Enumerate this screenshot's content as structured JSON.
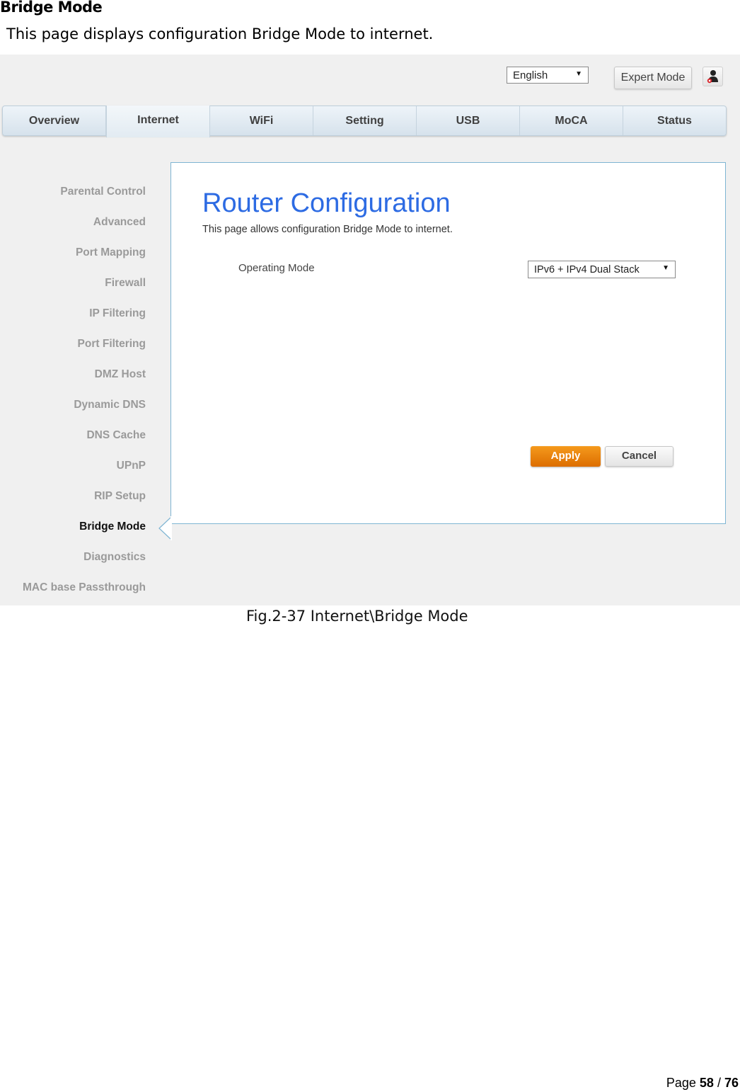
{
  "document": {
    "heading": "Bridge Mode",
    "intro": "This page displays configuration Bridge Mode to internet.",
    "caption": "Fig.2-37 Internet\\Bridge Mode",
    "page_label": "Page",
    "page_current": "58",
    "page_separator": "/",
    "page_total": "76"
  },
  "header": {
    "language": {
      "selected": "English",
      "icon": "dropdown-arrow-icon"
    },
    "expert_mode_label": "Expert Mode",
    "user_icon": "user-logout-icon"
  },
  "tabs": [
    {
      "label": "Overview",
      "active": false
    },
    {
      "label": "Internet",
      "active": true
    },
    {
      "label": "WiFi",
      "active": false
    },
    {
      "label": "Setting",
      "active": false
    },
    {
      "label": "USB",
      "active": false
    },
    {
      "label": "MoCA",
      "active": false
    },
    {
      "label": "Status",
      "active": false
    }
  ],
  "sidebar": {
    "items": [
      {
        "label": "Parental Control",
        "active": false
      },
      {
        "label": "Advanced",
        "active": false
      },
      {
        "label": "Port Mapping",
        "active": false
      },
      {
        "label": "Firewall",
        "active": false
      },
      {
        "label": "IP Filtering",
        "active": false
      },
      {
        "label": "Port Filtering",
        "active": false
      },
      {
        "label": "DMZ Host",
        "active": false
      },
      {
        "label": "Dynamic DNS",
        "active": false
      },
      {
        "label": "DNS Cache",
        "active": false
      },
      {
        "label": "UPnP",
        "active": false
      },
      {
        "label": "RIP Setup",
        "active": false
      },
      {
        "label": "Bridge Mode",
        "active": true
      },
      {
        "label": "Diagnostics",
        "active": false
      },
      {
        "label": "MAC base Passthrough",
        "active": false
      }
    ]
  },
  "panel": {
    "title": "Router Configuration",
    "description": "This page allows configuration Bridge Mode to internet.",
    "operating_mode": {
      "label": "Operating Mode",
      "selected": "IPv6 + IPv4 Dual Stack"
    },
    "apply_label": "Apply",
    "cancel_label": "Cancel"
  },
  "colors": {
    "title_blue": "#2d6be3",
    "apply_orange": "#ef8a0e",
    "panel_border": "#7fb5d3",
    "inactive_sidebar": "#9a9a9a"
  }
}
